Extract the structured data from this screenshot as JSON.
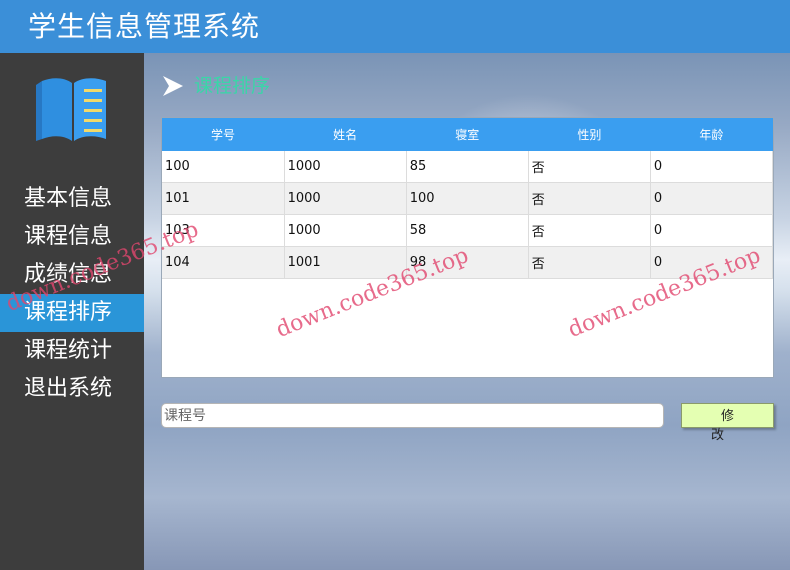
{
  "app": {
    "title": "学生信息管理系统"
  },
  "sidebar": {
    "items": [
      {
        "label": "基本信息"
      },
      {
        "label": "课程信息"
      },
      {
        "label": "成绩信息"
      },
      {
        "label": "课程排序",
        "active": true
      },
      {
        "label": "课程统计"
      },
      {
        "label": "退出系统"
      }
    ]
  },
  "section": {
    "title": "课程排序"
  },
  "table": {
    "columns": [
      "学号",
      "姓名",
      "寝室",
      "性别",
      "年龄"
    ],
    "rows": [
      [
        "100",
        "1000",
        "85",
        "否",
        "0"
      ],
      [
        "101",
        "1000",
        "100",
        "否",
        "0"
      ],
      [
        "103",
        "1000",
        "58",
        "否",
        "0"
      ],
      [
        "104",
        "1001",
        "98",
        "否",
        "0"
      ]
    ]
  },
  "form": {
    "course_placeholder": "课程号",
    "course_value": "",
    "modify_label": "修改"
  },
  "watermark": {
    "text": "down.code365.top"
  },
  "colors": {
    "titlebar": "#3b8fd8",
    "sidebar": "#3d3d3d",
    "active_item": "#2a95d8",
    "table_header": "#3a9ef0",
    "section_title": "#3ad6a8",
    "button": "#e4ffb2"
  }
}
